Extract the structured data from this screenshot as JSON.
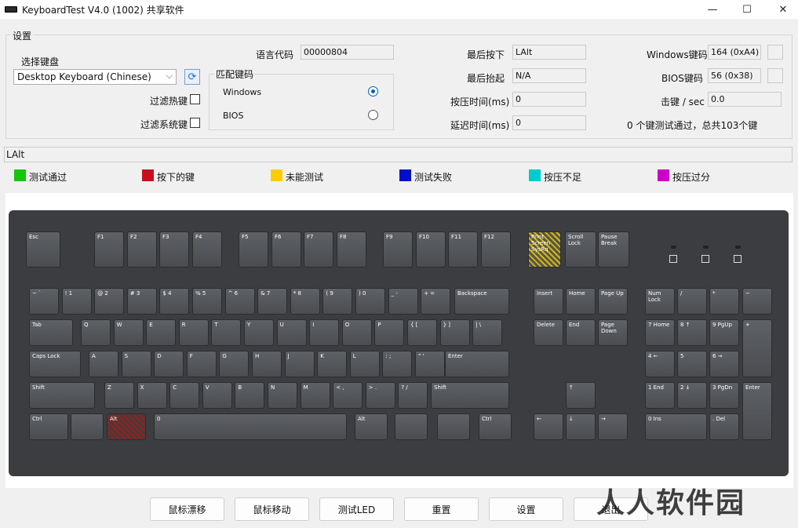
{
  "window": {
    "title": "KeyboardTest V4.0 (1002) 共享软件",
    "minimize": "—",
    "maximize": "☐",
    "close": "✕"
  },
  "settings": {
    "group_label": "设置",
    "select_keyboard_label": "选择键盘",
    "keyboard_value": "Desktop Keyboard (Chinese)",
    "filter_hotkeys_label": "过滤热键",
    "filter_syskeys_label": "过滤系统键",
    "language_code_label": "语言代码",
    "language_code_value": "00000804",
    "match_keycode_label": "匹配键码",
    "radio_windows": "Windows",
    "radio_bios": "BIOS",
    "last_pressed_label": "最后按下",
    "last_pressed_value": "LAlt",
    "last_released_label": "最后抬起",
    "last_released_value": "N/A",
    "press_time_label": "按压时间(ms)",
    "press_time_value": "0",
    "delay_time_label": "延迟时间(ms)",
    "delay_time_value": "0",
    "windows_keycode_label": "Windows键码",
    "windows_keycode_value": "164 (0xA4)",
    "bios_keycode_label": "BIOS键码",
    "bios_keycode_value": "56 (0x38)",
    "keys_per_sec_label": "击键 / sec",
    "keys_per_sec_value": "0.0",
    "summary": "0 个键测试通过，总共103个键"
  },
  "status_text": "LAlt",
  "legend": [
    {
      "label": "测试通过",
      "color": "#16c60c"
    },
    {
      "label": "按下的键",
      "color": "#c50f1f"
    },
    {
      "label": "未能测试",
      "color": "#ffcc00"
    },
    {
      "label": "测试失败",
      "color": "#0010c8"
    },
    {
      "label": "按压不足",
      "color": "#00cccc"
    },
    {
      "label": "按压过分",
      "color": "#cc00cc"
    }
  ],
  "keys": {
    "esc": "Esc",
    "f1": "F1",
    "f2": "F2",
    "f3": "F3",
    "f4": "F4",
    "f5": "F5",
    "f6": "F6",
    "f7": "F7",
    "f8": "F8",
    "f9": "F9",
    "f10": "F10",
    "f11": "F11",
    "f12": "F12",
    "prtsc": "Print Screen SysRq",
    "scroll": "Scroll Lock",
    "pause": "Pause Break",
    "backspace": "Backspace",
    "tab": "Tab",
    "caps": "Caps Lock",
    "enter": "Enter",
    "shift": "Shift",
    "ctrl": "Ctrl",
    "alt": "Alt",
    "space": "0",
    "insert": "Insert",
    "home": "Home",
    "pageup": "Page Up",
    "delete": "Delete",
    "end": "End",
    "pagedown": "Page Down",
    "numlock": "Num Lock",
    "n7": "7 Home",
    "n8": "8 ↑",
    "n9": "9 PgUp",
    "n4": "4 ←",
    "n5": "5",
    "n6": "6 →",
    "n1": "1 End",
    "n2": "2 ↓",
    "n3": "3 PgDn",
    "n0": "0 Ins",
    "ndot": ". Del",
    "nslash": "/",
    "nstar": "*",
    "nminus": "−",
    "nplus": "+",
    "up": "↑",
    "down": "↓",
    "left": "←",
    "right": "→",
    "row1": [
      "~ `",
      "! 1",
      "@ 2",
      "# 3",
      "$ 4",
      "% 5",
      "^ 6",
      "& 7",
      "* 8",
      "( 9",
      ") 0",
      "_ -",
      "+ ="
    ],
    "row2": [
      "Q",
      "W",
      "E",
      "R",
      "T",
      "Y",
      "U",
      "I",
      "O",
      "P",
      "{ [",
      "} ]",
      "| \\"
    ],
    "row3": [
      "A",
      "S",
      "D",
      "F",
      "G",
      "H",
      "J",
      "K",
      "L",
      ": ;",
      "\" '"
    ],
    "row4": [
      "Z",
      "X",
      "C",
      "V",
      "B",
      "N",
      "M",
      "< ,",
      "> .",
      "? /"
    ]
  },
  "buttons": {
    "mouse_drift": "鼠标漂移",
    "mouse_move": "鼠标移动",
    "test_led": "测试LED",
    "reset": "重置",
    "settings": "设置",
    "exit": "退出"
  },
  "watermark": "人人软件园"
}
